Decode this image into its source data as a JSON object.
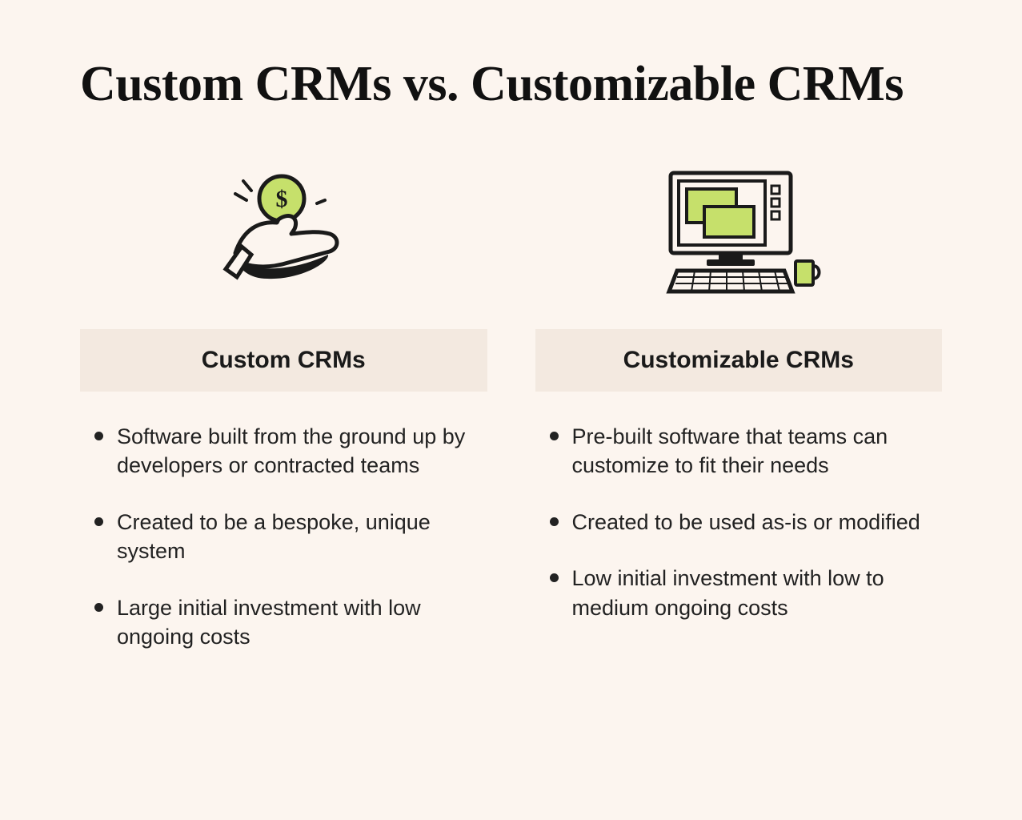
{
  "title": "Custom CRMs vs. Customizable CRMs",
  "left": {
    "heading": "Custom CRMs",
    "bullets": [
      "Software built from the ground up by developers or contracted teams",
      "Created to be a bespoke, unique system",
      "Large initial investment with low ongoing costs"
    ]
  },
  "right": {
    "heading": "Customizable CRMs",
    "bullets": [
      "Pre-built software that teams can customize to fit their needs",
      "Created to be used as-is or modified",
      "Low initial investment with low to medium ongoing costs"
    ]
  }
}
